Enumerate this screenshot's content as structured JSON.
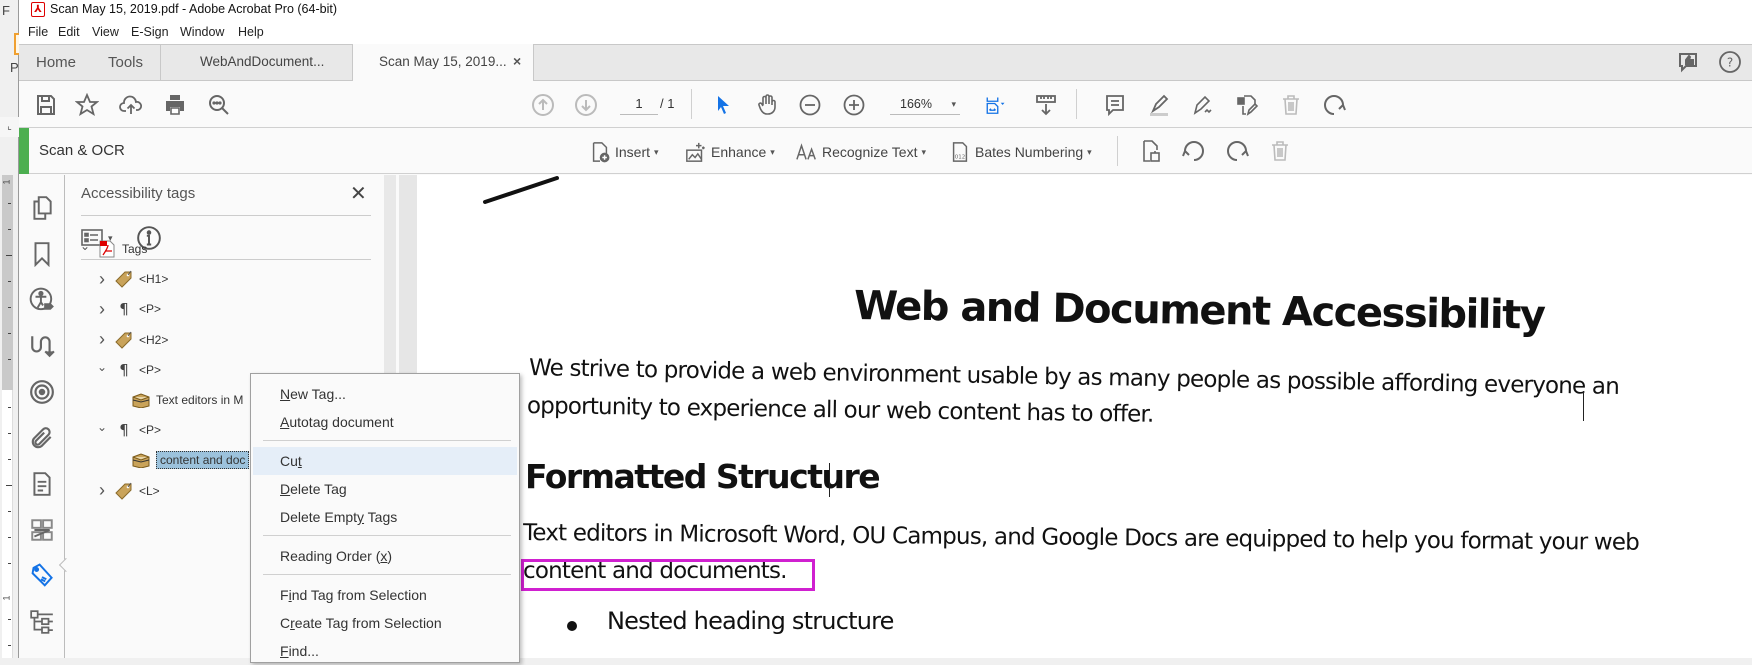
{
  "background_window": {
    "partial_letters": [
      "F",
      "P"
    ]
  },
  "window": {
    "title": "Scan May 15, 2019.pdf - Adobe Acrobat Pro (64-bit)"
  },
  "menu": [
    "File",
    "Edit",
    "View",
    "E-Sign",
    "Window",
    "Help"
  ],
  "tabs": {
    "home": "Home",
    "tools": "Tools",
    "docs": [
      {
        "label": "WebAndDocument...",
        "active": false
      },
      {
        "label": "Scan May 15, 2019...",
        "active": true,
        "close": "×"
      }
    ]
  },
  "toolbar": {
    "current_page": "1",
    "total_pages": "/ 1",
    "zoom": "166%",
    "zoom_caret": "▾",
    "icons": [
      "save-icon",
      "star-icon",
      "cloud-upload-icon",
      "print-icon",
      "search-icon",
      "page-up-icon",
      "page-down-icon",
      "select-arrow-icon",
      "hand-icon",
      "zoom-out-icon",
      "zoom-in-icon",
      "fit-page-icon",
      "scroll-mode-icon",
      "comment-icon",
      "highlight-icon",
      "sign-icon",
      "edit-pdf-icon",
      "delete-icon",
      "rotate-icon"
    ],
    "accent": "#1473e6"
  },
  "scan_bar": {
    "title": "Scan & OCR",
    "accent": "#4caf50",
    "buttons": [
      {
        "label": "Insert",
        "icon": "insert-page-icon"
      },
      {
        "label": "Enhance",
        "icon": "enhance-icon"
      },
      {
        "label": "Recognize Text",
        "icon": "recognize-text-icon"
      },
      {
        "label": "Bates Numbering",
        "icon": "bates-numbering-icon"
      }
    ],
    "dropdown_caret": "▾"
  },
  "rail": {
    "items": [
      "page-thumbnails-icon",
      "bookmarks-icon",
      "accessibility-icon",
      "reading-order-icon",
      "content-icon",
      "attachments-icon",
      "document-icon",
      "compare-icon",
      "tags-icon",
      "structure-icon"
    ],
    "active": "tags-icon"
  },
  "panel": {
    "title": "Accessibility tags",
    "close": "✕",
    "tree": [
      {
        "label": "Tags",
        "level": 0,
        "expanded": true,
        "icon": "pdf-icon"
      },
      {
        "label": "<H1>",
        "level": 1,
        "expanded": false,
        "icon": "tag-icon"
      },
      {
        "label": "<P>",
        "level": 1,
        "expanded": false,
        "icon": "paragraph-icon"
      },
      {
        "label": "<H2>",
        "level": 1,
        "expanded": false,
        "icon": "tag-icon"
      },
      {
        "label": "<P>",
        "level": 1,
        "expanded": true,
        "icon": "paragraph-icon"
      },
      {
        "label": "Text editors in M",
        "level": 2,
        "icon": "content-box-icon"
      },
      {
        "label": "<P>",
        "level": 1,
        "expanded": true,
        "icon": "paragraph-icon"
      },
      {
        "label": "content and doc",
        "level": 2,
        "icon": "content-box-icon",
        "selected": true
      },
      {
        "label": "<L>",
        "level": 1,
        "expanded": false,
        "icon": "tag-icon"
      }
    ]
  },
  "context_menu": {
    "items": [
      {
        "label": "New Tag...",
        "key": "N"
      },
      {
        "label": "Autotag document",
        "key": "A"
      },
      {
        "separator": true
      },
      {
        "label": "Cut",
        "key": "t",
        "hover": true
      },
      {
        "label": "Delete Tag",
        "key": "D"
      },
      {
        "label": "Delete Empty Tags",
        "key": "y"
      },
      {
        "separator": true
      },
      {
        "label": "Reading Order (x)",
        "key": "x"
      },
      {
        "separator": true
      },
      {
        "label": "Find Tag from Selection",
        "key": "i"
      },
      {
        "label": "Create Tag from Selection",
        "key": "r"
      },
      {
        "label": "Find...",
        "key": "F"
      }
    ]
  },
  "document": {
    "title": "Web and Document Accessibility",
    "para1_line1": "We strive to provide a web environment usable by as many people as possible affording everyone an",
    "para1_line2": "opportunity to experience all our web content has to offer.",
    "heading2": "Formatted Structure",
    "para2_line1": "Text editors in Microsoft Word, OU Campus, and Google Docs are equipped to help you format your web",
    "para2_line2": "content and documents.",
    "bullets": [
      "Nested heading structure"
    ],
    "highlight_color": "#d020d0"
  },
  "vertical_ruler": {
    "labels": [
      "1",
      "1"
    ]
  }
}
